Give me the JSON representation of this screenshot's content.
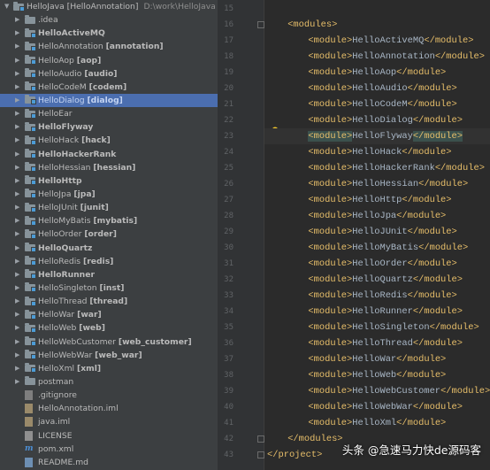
{
  "tree": {
    "root": {
      "name": "HelloJava [HelloAnnotation]",
      "path": "D:\\work\\HelloJava"
    },
    "items": [
      {
        "plain": ".idea",
        "mod": "",
        "kind": "dir",
        "arrow": true,
        "bold": false
      },
      {
        "plain": "HelloActiveMQ",
        "mod": "",
        "kind": "module",
        "arrow": true,
        "bold": true
      },
      {
        "plain": "HelloAnnotation",
        "mod": "[annotation]",
        "kind": "module",
        "arrow": true,
        "bold": false
      },
      {
        "plain": "HelloAop",
        "mod": "[aop]",
        "kind": "module",
        "arrow": true,
        "bold": false
      },
      {
        "plain": "HelloAudio",
        "mod": "[audio]",
        "kind": "module",
        "arrow": true,
        "bold": false
      },
      {
        "plain": "HelloCodeM",
        "mod": "[codem]",
        "kind": "module",
        "arrow": true,
        "bold": false
      },
      {
        "plain": "HelloDialog",
        "mod": "[dialog]",
        "kind": "module",
        "arrow": true,
        "bold": false,
        "selected": true
      },
      {
        "plain": "HelloEar",
        "mod": "",
        "kind": "module",
        "arrow": true,
        "bold": false
      },
      {
        "plain": "HelloFlyway",
        "mod": "",
        "kind": "module",
        "arrow": true,
        "bold": true
      },
      {
        "plain": "HelloHack",
        "mod": "[hack]",
        "kind": "module",
        "arrow": true,
        "bold": false
      },
      {
        "plain": "HelloHackerRank",
        "mod": "",
        "kind": "module",
        "arrow": true,
        "bold": true
      },
      {
        "plain": "HelloHessian",
        "mod": "[hessian]",
        "kind": "module",
        "arrow": true,
        "bold": false
      },
      {
        "plain": "HelloHttp",
        "mod": "",
        "kind": "module",
        "arrow": true,
        "bold": true
      },
      {
        "plain": "HelloJpa",
        "mod": "[jpa]",
        "kind": "module",
        "arrow": true,
        "bold": false
      },
      {
        "plain": "HelloJUnit",
        "mod": "[junit]",
        "kind": "module",
        "arrow": true,
        "bold": false
      },
      {
        "plain": "HelloMyBatis",
        "mod": "[mybatis]",
        "kind": "module",
        "arrow": true,
        "bold": false
      },
      {
        "plain": "HelloOrder",
        "mod": "[order]",
        "kind": "module",
        "arrow": true,
        "bold": false
      },
      {
        "plain": "HelloQuartz",
        "mod": "",
        "kind": "module",
        "arrow": true,
        "bold": true
      },
      {
        "plain": "HelloRedis",
        "mod": "[redis]",
        "kind": "module",
        "arrow": true,
        "bold": false
      },
      {
        "plain": "HelloRunner",
        "mod": "",
        "kind": "module",
        "arrow": true,
        "bold": true
      },
      {
        "plain": "HelloSingleton",
        "mod": "[inst]",
        "kind": "module",
        "arrow": true,
        "bold": false
      },
      {
        "plain": "HelloThread",
        "mod": "[thread]",
        "kind": "module",
        "arrow": true,
        "bold": false
      },
      {
        "plain": "HelloWar",
        "mod": "[war]",
        "kind": "module",
        "arrow": true,
        "bold": false
      },
      {
        "plain": "HelloWeb",
        "mod": "[web]",
        "kind": "module",
        "arrow": true,
        "bold": false
      },
      {
        "plain": "HelloWebCustomer",
        "mod": "[web_customer]",
        "kind": "module",
        "arrow": true,
        "bold": false
      },
      {
        "plain": "HelloWebWar",
        "mod": "[web_war]",
        "kind": "module",
        "arrow": true,
        "bold": false
      },
      {
        "plain": "HelloXml",
        "mod": "[xml]",
        "kind": "module",
        "arrow": true,
        "bold": false
      },
      {
        "plain": "postman",
        "mod": "",
        "kind": "dir",
        "arrow": true,
        "bold": false
      },
      {
        "plain": ".gitignore",
        "mod": "",
        "kind": "git",
        "arrow": false,
        "bold": false
      },
      {
        "plain": "HelloAnnotation.iml",
        "mod": "",
        "kind": "iml",
        "arrow": false,
        "bold": false
      },
      {
        "plain": "java.iml",
        "mod": "",
        "kind": "iml",
        "arrow": false,
        "bold": false
      },
      {
        "plain": "LICENSE",
        "mod": "",
        "kind": "file",
        "arrow": false,
        "bold": false
      },
      {
        "plain": "pom.xml",
        "mod": "",
        "kind": "maven",
        "arrow": false,
        "bold": false
      },
      {
        "plain": "README.md",
        "mod": "",
        "kind": "md",
        "arrow": false,
        "bold": false
      }
    ]
  },
  "editor": {
    "lines": [
      {
        "num": "15",
        "indent": 0,
        "kind": "blank"
      },
      {
        "num": "16",
        "indent": 1,
        "kind": "open",
        "tag": "modules"
      },
      {
        "num": "17",
        "indent": 2,
        "kind": "module",
        "text": "HelloActiveMQ"
      },
      {
        "num": "18",
        "indent": 2,
        "kind": "module",
        "text": "HelloAnnotation"
      },
      {
        "num": "19",
        "indent": 2,
        "kind": "module",
        "text": "HelloAop"
      },
      {
        "num": "20",
        "indent": 2,
        "kind": "module",
        "text": "HelloAudio"
      },
      {
        "num": "21",
        "indent": 2,
        "kind": "module",
        "text": "HelloCodeM"
      },
      {
        "num": "22",
        "indent": 2,
        "kind": "module",
        "text": "HelloDialog"
      },
      {
        "num": "23",
        "indent": 2,
        "kind": "module",
        "text": "HelloFlyway",
        "current": true
      },
      {
        "num": "24",
        "indent": 2,
        "kind": "module",
        "text": "HelloHack"
      },
      {
        "num": "25",
        "indent": 2,
        "kind": "module",
        "text": "HelloHackerRank"
      },
      {
        "num": "26",
        "indent": 2,
        "kind": "module",
        "text": "HelloHessian"
      },
      {
        "num": "27",
        "indent": 2,
        "kind": "module",
        "text": "HelloHttp"
      },
      {
        "num": "28",
        "indent": 2,
        "kind": "module",
        "text": "HelloJpa"
      },
      {
        "num": "29",
        "indent": 2,
        "kind": "module",
        "text": "HelloJUnit"
      },
      {
        "num": "30",
        "indent": 2,
        "kind": "module",
        "text": "HelloMyBatis"
      },
      {
        "num": "31",
        "indent": 2,
        "kind": "module",
        "text": "HelloOrder"
      },
      {
        "num": "32",
        "indent": 2,
        "kind": "module",
        "text": "HelloQuartz"
      },
      {
        "num": "33",
        "indent": 2,
        "kind": "module",
        "text": "HelloRedis"
      },
      {
        "num": "34",
        "indent": 2,
        "kind": "module",
        "text": "HelloRunner"
      },
      {
        "num": "35",
        "indent": 2,
        "kind": "module",
        "text": "HelloSingleton"
      },
      {
        "num": "36",
        "indent": 2,
        "kind": "module",
        "text": "HelloThread"
      },
      {
        "num": "37",
        "indent": 2,
        "kind": "module",
        "text": "HelloWar"
      },
      {
        "num": "38",
        "indent": 2,
        "kind": "module",
        "text": "HelloWeb"
      },
      {
        "num": "39",
        "indent": 2,
        "kind": "module",
        "text": "HelloWebCustomer"
      },
      {
        "num": "40",
        "indent": 2,
        "kind": "module",
        "text": "HelloWebWar"
      },
      {
        "num": "41",
        "indent": 2,
        "kind": "module",
        "text": "HelloXml"
      },
      {
        "num": "42",
        "indent": 1,
        "kind": "close",
        "tag": "modules"
      },
      {
        "num": "43",
        "indent": 0,
        "kind": "close",
        "tag": "project"
      }
    ]
  },
  "watermark": "头条 @急速马力快de源码客",
  "colors": {
    "tag": "#e8bf6a",
    "text": "#a9b7c6",
    "selected": "#4b6eaf",
    "match": "#3b514d"
  }
}
